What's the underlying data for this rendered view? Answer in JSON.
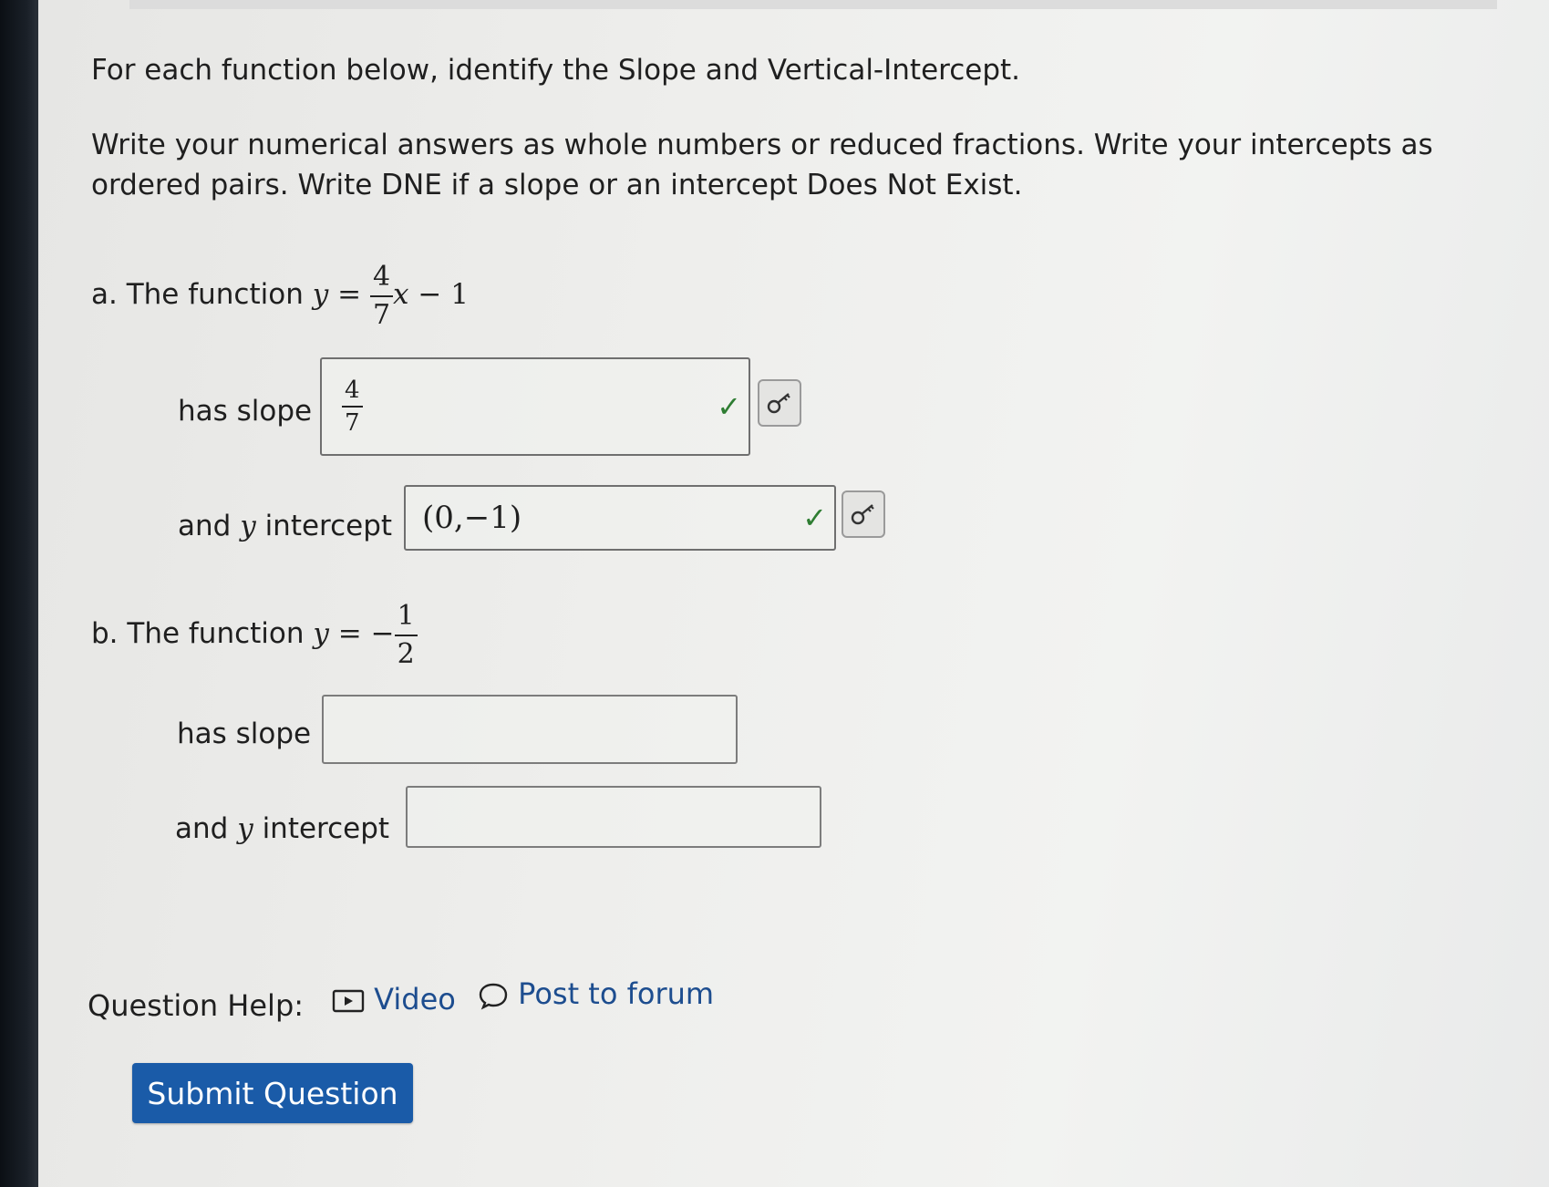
{
  "instructions": {
    "line1": "For each function below, identify the Slope and Vertical-Intercept.",
    "line2": "Write your numerical answers as whole numbers or reduced fractions. Write your intercepts as",
    "line3": "ordered pairs. Write DNE if a slope or an intercept Does Not Exist."
  },
  "part_a": {
    "prefix": "a. The function",
    "y": "y",
    "equals": "=",
    "frac_num": "4",
    "frac_den": "7",
    "x": "x",
    "minus": "−",
    "const": "1",
    "slope_label": "has slope",
    "slope_answer_num": "4",
    "slope_answer_den": "7",
    "intercept_label_pre": "and",
    "intercept_label_y": "y",
    "intercept_label_post": "intercept",
    "intercept_answer": "(0,−1)",
    "status_icon": "check-icon"
  },
  "part_b": {
    "prefix": "b. The function",
    "y": "y",
    "equals": "=",
    "neg": "−",
    "frac_num": "1",
    "frac_den": "2",
    "slope_label": "has slope",
    "slope_answer": "",
    "intercept_label_pre": "and",
    "intercept_label_y": "y",
    "intercept_label_post": "intercept",
    "intercept_answer": ""
  },
  "help": {
    "label": "Question Help:",
    "video": "Video",
    "forum": "Post to forum"
  },
  "submit_label": "Submit Question",
  "colors": {
    "accent": "#1a5ba8",
    "link": "#1d4d8f",
    "correct": "#2e7d32"
  }
}
